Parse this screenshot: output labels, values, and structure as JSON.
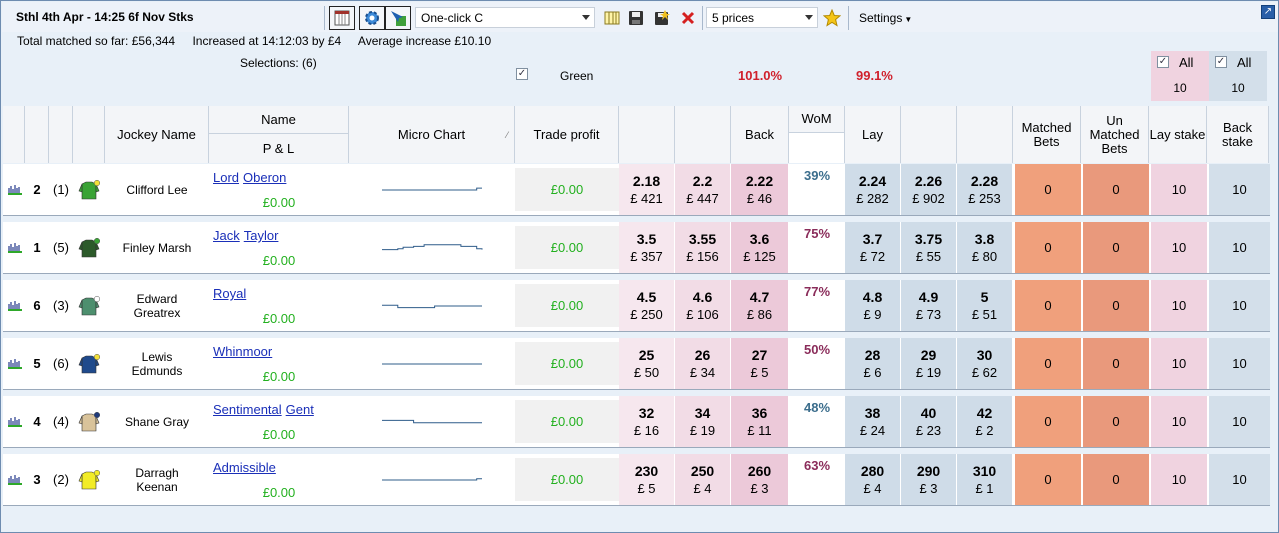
{
  "toolbar": {
    "title": "Sthl 4th Apr - 14:25 6f Nov Stks",
    "oneclick_value": "One-click C",
    "prices_value": "5 prices",
    "settings_label": "Settings"
  },
  "info": {
    "total_matched": "Total matched so far: £56,344",
    "increased": "Increased at 14:12:03 by £4",
    "average": "Average increase £10.10"
  },
  "selections_label": "Selections: (6)",
  "green_label": "Green",
  "back_book_pct": "101.0%",
  "lay_book_pct": "99.1%",
  "all_lay": {
    "label": "All",
    "value": "10"
  },
  "all_back": {
    "label": "All",
    "value": "10"
  },
  "headers": {
    "jockey": "Jockey Name",
    "name": "Name",
    "pl": "P & L",
    "micro_chart": "Micro Chart",
    "trade_profit": "Trade profit",
    "back": "Back",
    "wom": "WoM",
    "lay": "Lay",
    "matched_bets": "Matched Bets",
    "unmatched_bets": "Un Matched Bets",
    "lay_stake": "Lay stake",
    "back_stake": "Back stake"
  },
  "colors": {
    "silk_1": "#3aa335",
    "silk_2": "#2c5a2a",
    "silk_3": "#4d8f6e",
    "silk_4": "#1f4a8c",
    "silk_5": "#d9c39a",
    "silk_6": "#f2ec26"
  },
  "runners": [
    {
      "num": "2",
      "draw": "(1)",
      "jockey": "Clifford Lee",
      "name_words": [
        "Lord",
        "Oberon"
      ],
      "pl": "£0.00",
      "trade": "£0.00",
      "back": [
        {
          "p": "2.18",
          "v": "£ 421"
        },
        {
          "p": "2.2",
          "v": "£ 447"
        },
        {
          "p": "2.22",
          "v": "£ 46"
        }
      ],
      "wom": "39%",
      "wom_color": "#3b6d8c",
      "lay": [
        {
          "p": "2.24",
          "v": "£ 282"
        },
        {
          "p": "2.26",
          "v": "£ 902"
        },
        {
          "p": "2.28",
          "v": "£ 253"
        }
      ],
      "matched": "0",
      "unmatched": "0",
      "lay_stake": "10",
      "back_stake": "10",
      "silk": "silk_1",
      "cap": "#f2e03a",
      "chart": [
        0.5,
        0.5,
        0.5,
        0.5,
        0.5,
        0.5,
        0.5,
        0.5,
        0.5,
        0.5,
        0.5,
        0.5,
        0.5,
        0.5,
        0.5,
        0.5,
        0.5,
        0.5,
        0.38,
        0.38
      ]
    },
    {
      "num": "1",
      "draw": "(5)",
      "jockey": "Finley Marsh",
      "name_words": [
        "Jack",
        "Taylor"
      ],
      "pl": "£0.00",
      "trade": "£0.00",
      "back": [
        {
          "p": "3.5",
          "v": "£ 357"
        },
        {
          "p": "3.55",
          "v": "£ 156"
        },
        {
          "p": "3.6",
          "v": "£ 125"
        }
      ],
      "wom": "75%",
      "wom_color": "#8a2c5a",
      "lay": [
        {
          "p": "3.7",
          "v": "£ 72"
        },
        {
          "p": "3.75",
          "v": "£ 55"
        },
        {
          "p": "3.8",
          "v": "£ 80"
        }
      ],
      "matched": "0",
      "unmatched": "0",
      "lay_stake": "10",
      "back_stake": "10",
      "silk": "silk_2",
      "cap": "#3aa335",
      "chart": [
        0.6,
        0.6,
        0.6,
        0.55,
        0.45,
        0.45,
        0.4,
        0.4,
        0.3,
        0.3,
        0.3,
        0.3,
        0.3,
        0.3,
        0.3,
        0.4,
        0.4,
        0.4,
        0.55,
        0.6
      ]
    },
    {
      "num": "6",
      "draw": "(3)",
      "jockey": "Edward Greatrex",
      "name_words": [
        "Royal"
      ],
      "pl": "£0.00",
      "trade": "£0.00",
      "back": [
        {
          "p": "4.5",
          "v": "£ 250"
        },
        {
          "p": "4.6",
          "v": "£ 106"
        },
        {
          "p": "4.7",
          "v": "£ 86"
        }
      ],
      "wom": "77%",
      "wom_color": "#8a2c5a",
      "lay": [
        {
          "p": "4.8",
          "v": "£ 9"
        },
        {
          "p": "4.9",
          "v": "£ 73"
        },
        {
          "p": "5",
          "v": "£ 51"
        }
      ],
      "matched": "0",
      "unmatched": "0",
      "lay_stake": "10",
      "back_stake": "10",
      "silk": "silk_3",
      "cap": "#ffffff",
      "chart": [
        0.45,
        0.45,
        0.45,
        0.6,
        0.6,
        0.6,
        0.6,
        0.6,
        0.6,
        0.6,
        0.5,
        0.5,
        0.5,
        0.5,
        0.5,
        0.5,
        0.5,
        0.5,
        0.5,
        0.5
      ]
    },
    {
      "num": "5",
      "draw": "(6)",
      "jockey": "Lewis Edmunds",
      "name_words": [
        "Whinmoor"
      ],
      "pl": "£0.00",
      "trade": "£0.00",
      "back": [
        {
          "p": "25",
          "v": "£ 50"
        },
        {
          "p": "26",
          "v": "£ 34"
        },
        {
          "p": "27",
          "v": "£ 5"
        }
      ],
      "wom": "50%",
      "wom_color": "#8a2c5a",
      "lay": [
        {
          "p": "28",
          "v": "£ 6"
        },
        {
          "p": "29",
          "v": "£ 19"
        },
        {
          "p": "30",
          "v": "£ 62"
        }
      ],
      "matched": "0",
      "unmatched": "0",
      "lay_stake": "10",
      "back_stake": "10",
      "silk": "silk_4",
      "cap": "#f2e03a",
      "chart": [
        0.5,
        0.5,
        0.5,
        0.5,
        0.5,
        0.5,
        0.5,
        0.5,
        0.5,
        0.5,
        0.5,
        0.5,
        0.5,
        0.5,
        0.5,
        0.5,
        0.5,
        0.5,
        0.5,
        0.5
      ]
    },
    {
      "num": "4",
      "draw": "(4)",
      "jockey": "Shane Gray",
      "name_words": [
        "Sentimental",
        "Gent"
      ],
      "pl": "£0.00",
      "trade": "£0.00",
      "back": [
        {
          "p": "32",
          "v": "£ 16"
        },
        {
          "p": "34",
          "v": "£ 19"
        },
        {
          "p": "36",
          "v": "£ 11"
        }
      ],
      "wom": "48%",
      "wom_color": "#3b6d8c",
      "lay": [
        {
          "p": "38",
          "v": "£ 24"
        },
        {
          "p": "40",
          "v": "£ 23"
        },
        {
          "p": "42",
          "v": "£ 2"
        }
      ],
      "matched": "0",
      "unmatched": "0",
      "lay_stake": "10",
      "back_stake": "10",
      "silk": "silk_5",
      "cap": "#1f3a7a",
      "chart": [
        0.4,
        0.4,
        0.4,
        0.4,
        0.4,
        0.4,
        0.55,
        0.55,
        0.55,
        0.55,
        0.55,
        0.55,
        0.55,
        0.55,
        0.55,
        0.55,
        0.55,
        0.55,
        0.55,
        0.55
      ]
    },
    {
      "num": "3",
      "draw": "(2)",
      "jockey": "Darragh Keenan",
      "name_words": [
        "Admissible"
      ],
      "pl": "£0.00",
      "trade": "£0.00",
      "back": [
        {
          "p": "230",
          "v": "£ 5"
        },
        {
          "p": "250",
          "v": "£ 4"
        },
        {
          "p": "260",
          "v": "£ 3"
        }
      ],
      "wom": "63%",
      "wom_color": "#8a2c5a",
      "lay": [
        {
          "p": "280",
          "v": "£ 4"
        },
        {
          "p": "290",
          "v": "£ 3"
        },
        {
          "p": "310",
          "v": "£ 1"
        }
      ],
      "matched": "0",
      "unmatched": "0",
      "lay_stake": "10",
      "back_stake": "10",
      "silk": "silk_6",
      "cap": "#f2ec26",
      "chart": [
        0.5,
        0.5,
        0.5,
        0.5,
        0.5,
        0.5,
        0.5,
        0.5,
        0.5,
        0.5,
        0.5,
        0.5,
        0.5,
        0.5,
        0.5,
        0.5,
        0.5,
        0.5,
        0.42,
        0.42
      ]
    }
  ]
}
